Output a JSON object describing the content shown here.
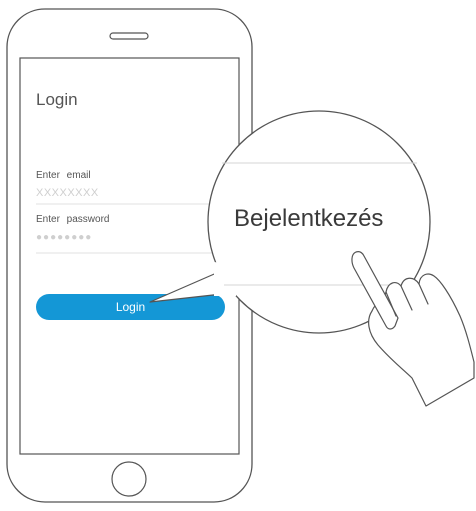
{
  "screen": {
    "title": "Login",
    "email": {
      "label": "Enter   email",
      "value": "XXXXXXXX"
    },
    "password": {
      "label": "Enter   password",
      "masked_value": "●●●●●●●●"
    },
    "login_button": {
      "label": "Login",
      "color": "#1497d6"
    }
  },
  "callout": {
    "text": "Bejelentkezés"
  },
  "icons": [
    "phone-frame",
    "speaker-grille-icon",
    "home-button-icon",
    "hand-tap-icon",
    "magnifier-callout"
  ]
}
